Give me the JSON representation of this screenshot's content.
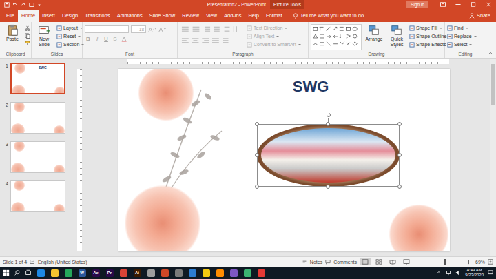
{
  "window": {
    "title": "Presentation2 - PowerPoint",
    "context": "Picture Tools",
    "sign_in": "Sign in"
  },
  "tabs": [
    {
      "label": "File",
      "selected": false
    },
    {
      "label": "Home",
      "selected": true
    },
    {
      "label": "Insert",
      "selected": false
    },
    {
      "label": "Design",
      "selected": false
    },
    {
      "label": "Transitions",
      "selected": false
    },
    {
      "label": "Animations",
      "selected": false
    },
    {
      "label": "Slide Show",
      "selected": false
    },
    {
      "label": "Review",
      "selected": false
    },
    {
      "label": "View",
      "selected": false
    },
    {
      "label": "Add-ins",
      "selected": false
    },
    {
      "label": "Help",
      "selected": false
    },
    {
      "label": "Format",
      "selected": false
    }
  ],
  "tell_me": "Tell me what you want to do",
  "share": "Share",
  "ribbon": [
    {
      "name": "Clipboard",
      "kind": "clipboard",
      "items": [
        {
          "label": "Paste",
          "kind": "large",
          "disabled": false
        }
      ]
    },
    {
      "name": "Slides",
      "kind": "slides",
      "items": [
        {
          "label": "New Slide",
          "kind": "large",
          "disabled": false
        },
        {
          "label": "Layout",
          "kind": "small",
          "disabled": false
        },
        {
          "label": "Reset",
          "kind": "small",
          "disabled": false
        },
        {
          "label": "Section",
          "kind": "small",
          "disabled": false
        }
      ]
    },
    {
      "name": "Font",
      "kind": "font",
      "items": [
        {
          "label": "",
          "kind": "field",
          "disabled": true
        },
        {
          "label": "18",
          "kind": "field",
          "disabled": true
        },
        {
          "label": "B",
          "kind": "glyph",
          "disabled": true
        },
        {
          "label": "I",
          "kind": "glyph",
          "disabled": true
        },
        {
          "label": "U",
          "kind": "glyph",
          "disabled": true
        },
        {
          "label": "S",
          "kind": "glyph",
          "disabled": true
        }
      ]
    },
    {
      "name": "Paragraph",
      "kind": "paragraph",
      "items": [
        {
          "label": "Text Direction",
          "kind": "small",
          "disabled": true
        },
        {
          "label": "Align Text",
          "kind": "small",
          "disabled": true
        },
        {
          "label": "Convert to SmartArt",
          "kind": "small",
          "disabled": true
        }
      ]
    },
    {
      "name": "Drawing",
      "kind": "drawing",
      "items": [
        {
          "label": "Arrange",
          "kind": "large",
          "disabled": false
        },
        {
          "label": "Quick Styles",
          "kind": "large",
          "disabled": false
        },
        {
          "label": "Shape Fill",
          "kind": "small",
          "disabled": false
        },
        {
          "label": "Shape Outline",
          "kind": "small",
          "disabled": false
        },
        {
          "label": "Shape Effects",
          "kind": "small",
          "disabled": false
        }
      ]
    },
    {
      "name": "Editing",
      "kind": "editing",
      "items": [
        {
          "label": "Find",
          "kind": "small",
          "disabled": false
        },
        {
          "label": "Replace",
          "kind": "small",
          "disabled": false
        },
        {
          "label": "Select",
          "kind": "small",
          "disabled": false
        }
      ]
    }
  ],
  "thumbnails": [
    {
      "number": "1",
      "selected": true,
      "title": "SWG"
    },
    {
      "number": "2",
      "selected": false,
      "title": ""
    },
    {
      "number": "3",
      "selected": false,
      "title": ""
    },
    {
      "number": "4",
      "selected": false,
      "title": ""
    }
  ],
  "slide": {
    "title": "SWG",
    "picture": {
      "selected": true
    }
  },
  "status_bar": {
    "slide": "Slide 1 of 4",
    "language": "English (United States)",
    "notes": "Notes",
    "comments": "Comments",
    "zoom": "69%",
    "zoom_level": 0.55
  },
  "taskbar": {
    "apps": [
      {
        "label": "",
        "color": "#1e88e5"
      },
      {
        "label": "",
        "color": "#f4c430"
      },
      {
        "label": "",
        "color": "#26a65b"
      },
      {
        "label": "W",
        "color": "#2b579a"
      },
      {
        "label": "Ae",
        "color": "#2a0a4a"
      },
      {
        "label": "Pr",
        "color": "#2a0a4a"
      },
      {
        "label": "",
        "color": "#db4437"
      },
      {
        "label": "Ai",
        "color": "#3a1a00"
      },
      {
        "label": "",
        "color": "#9e9e9e"
      },
      {
        "label": "",
        "color": "#d24726"
      },
      {
        "label": "",
        "color": "#7a7a7a"
      },
      {
        "label": "",
        "color": "#2d7dd2"
      },
      {
        "label": "",
        "color": "#f2c811"
      },
      {
        "label": "",
        "color": "#ff8c00"
      },
      {
        "label": "",
        "color": "#7e57c2"
      },
      {
        "label": "",
        "color": "#3cb371"
      },
      {
        "label": "",
        "color": "#e53935"
      }
    ],
    "time": "4:49 AM",
    "date": "9/23/2020"
  }
}
